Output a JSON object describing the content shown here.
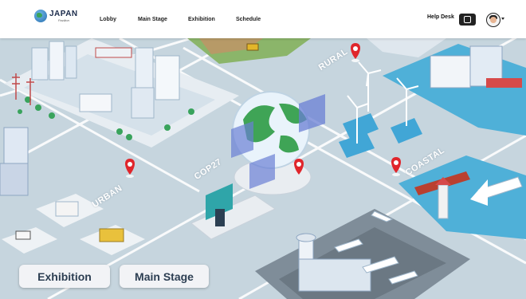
{
  "brand": {
    "name": "JAPAN",
    "tagline": "Pavilion"
  },
  "nav": {
    "items": [
      "Lobby",
      "Main Stage",
      "Exhibition",
      "Schedule"
    ]
  },
  "header": {
    "help_desk": "Help Desk"
  },
  "map": {
    "labels": [
      "URBAN",
      "COP27",
      "RURAL",
      "COASTAL"
    ]
  },
  "zones": {
    "buttons": [
      "Exhibition",
      "Main Stage"
    ]
  }
}
